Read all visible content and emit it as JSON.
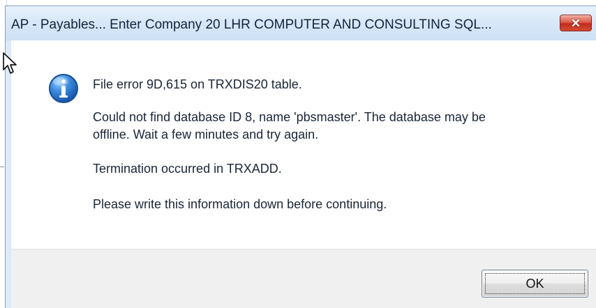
{
  "window": {
    "title": "AP - Payables... Enter     Company 20  LHR COMPUTER AND CONSULTING   SQL...",
    "close_symbol": "✕"
  },
  "dialog": {
    "icon": "information-icon",
    "messages": [
      "File error 9D,615 on TRXDIS20 table.",
      "Could not find database ID 8, name 'pbsmaster'. The database may be",
      "offline. Wait a few minutes and try again.",
      "Termination occurred in TRXADD.",
      "Please write this information down before continuing."
    ],
    "ok_label": "OK"
  },
  "colors": {
    "title_bar": "#d8e8f8",
    "close_button": "#c22b1f",
    "message_background": "#ffffff",
    "button_area": "#f0f0f0",
    "info_icon": "#2f73c9"
  },
  "cursor": {
    "icon": "mouse-pointer-icon"
  }
}
